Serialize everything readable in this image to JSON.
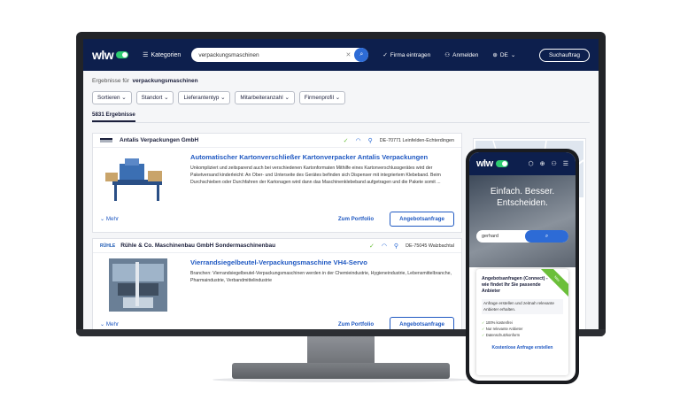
{
  "header": {
    "logo": "wlw",
    "kategorien": "Kategorien",
    "search_value": "verpackungsmaschinen",
    "firma_eintragen": "Firma eintragen",
    "anmelden": "Anmelden",
    "language": "DE",
    "suchauftrag": "Suchauftrag"
  },
  "results": {
    "prefix": "Ergebnisse für",
    "query": "verpackungsmaschinen",
    "count": "5831 Ergebnisse"
  },
  "filters": [
    "Sortieren",
    "Standort",
    "Lieferantentyp",
    "Mitarbeiteranzahl",
    "Firmenprofil"
  ],
  "cards": [
    {
      "company": "Antalis Verpackungen GmbH",
      "location": "DE-70771 Leinfelden-Echterdingen",
      "title": "Automatischer Kartonverschließer Kartonverpacker Antalis Verpackungen",
      "description": "Unkompliziert und zeitsparend auch bei verschiedenen Kartonformaten Mithilfe eines Kartonverschlussgerätes wird der Paketversand kinderleicht: An Ober- und Unterseite des Gerätes befinden sich Dispenser mit integriertem Klebeband. Beim Durchschieben oder Durchfahren der Kartonagen wird dann das Maschinenklebeband aufgetragen und die Pakete somit ...",
      "mehr": "Mehr",
      "portfolio": "Zum Portfolio",
      "angebot": "Angebotsanfrage"
    },
    {
      "company": "Rühle & Co. Maschinenbau GmbH Sondermaschinenbau",
      "logo_text": "RÜHLE",
      "location": "DE-75045 Walzbachtal",
      "title": "Vierrandsiegelbeutel-Verpackungsmaschine VH4-Servo",
      "description": "Branchen: Vierrandsiegelbeutel-Verpackungsmaschinen werden in der Chemieindustrie, Hygieneindustrie, Lebensmittelbranche, Pharmaindustrie, Verbandmittelindustrie",
      "mehr": "Mehr",
      "portfolio": "Zum Portfolio",
      "angebot": "Angebotsanfrage"
    }
  ],
  "phone": {
    "logo": "wlw",
    "slogan_line1": "Einfach. Besser.",
    "slogan_line2": "Entscheiden.",
    "search_value": "gerhard",
    "ribbon": "Neu",
    "card_title": "Angebotsanfragen (Connect) - wie findet Ihr Sie passende Anbieter",
    "card_sub": "Anfrage erstellen und zeitnah relevante Anbieter erhalten.",
    "card_list": [
      "100% kostenfrei",
      "Nur relevante Anbieter",
      "Datenschutzkonform"
    ],
    "card_link": "Kostenlose Anfrage erstellen"
  },
  "colors": {
    "header": "#0d1f4d",
    "accent": "#2d6bd6",
    "green": "#6bbf3a"
  }
}
